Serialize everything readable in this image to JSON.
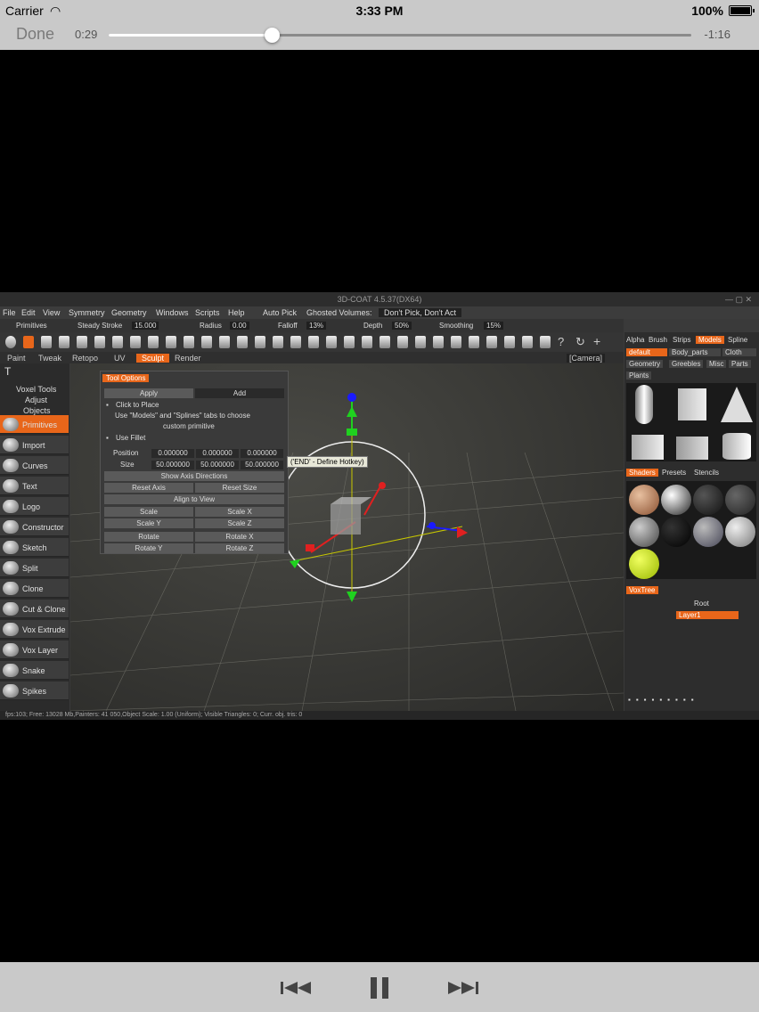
{
  "status_bar": {
    "carrier": "Carrier",
    "time": "3:33 PM",
    "battery": "100%"
  },
  "player": {
    "done": "Done",
    "elapsed": "0:29",
    "remaining": "-1:16",
    "progress": 0.28
  },
  "app": {
    "title": "3D-COAT 4.5.37(DX64)",
    "menu": [
      "File",
      "Edit",
      "View",
      "Symmetry",
      "Geometry",
      "Windows",
      "Scripts",
      "Help",
      "Auto Pick",
      "Ghosted Volumes:",
      "Don't Pick, Don't Act"
    ],
    "toolbar": {
      "primitives": "Primitives",
      "steady_stroke": "Steady Stroke",
      "steady_val": "15.000",
      "radius": "Radius",
      "radius_val": "0.00",
      "falloff": "Falloff",
      "falloff_val": "13%",
      "depth": "Depth",
      "depth_val": "50%",
      "smoothing": "Smoothing",
      "smoothing_val": "15%"
    },
    "room_tabs": [
      "Paint",
      "Tweak",
      "Retopo",
      "UV",
      "Sculpt",
      "Render"
    ],
    "active_room": "Sculpt",
    "camera": "[Camera]",
    "left_headers": [
      "Voxel Tools",
      "Adjust",
      "Objects"
    ],
    "left_tools": [
      "Primitives",
      "Import",
      "Curves",
      "Text",
      "Logo",
      "Constructor",
      "Sketch",
      "Split",
      "Clone",
      "Cut & Clone",
      "Vox Extrude",
      "Vox Layer",
      "Snake",
      "Spikes"
    ],
    "tool_options": {
      "title": "Tool Options",
      "apply": "Apply",
      "add": "Add",
      "click_to_place": "Click to Place",
      "hint1": "Use \"Models\" and \"Splines\" tabs to choose",
      "hint2": "custom primitive",
      "use_fillet": "Use Fillet",
      "position": "Position",
      "size": "Size",
      "pos_vals": [
        "0.000000",
        "0.000000",
        "0.000000"
      ],
      "size_vals": [
        "50.000000",
        "50.000000",
        "50.000000"
      ],
      "show_axis": "Show Axis Directions",
      "reset_axis": "Reset Axis",
      "reset_size": "Reset Size",
      "align": "Align to View",
      "scale": "Scale",
      "scale_x": "Scale X",
      "scale_y": "Scale Y",
      "scale_z": "Scale Z",
      "rotate": "Rotate",
      "rotate_x": "Rotate X",
      "rotate_y": "Rotate Y",
      "rotate_z": "Rotate Z"
    },
    "hotkey_tip": "('END' - Define Hotkey)",
    "right_tabs": [
      "Alpha",
      "Brush",
      "Strips",
      "Models",
      "Spline"
    ],
    "model_tabs": [
      "default",
      "Body_parts",
      "Cloth",
      "Geometry",
      "Greebles",
      "Misc",
      "Parts",
      "Plants"
    ],
    "shader_tabs": [
      "Shaders",
      "Presets",
      "Stencils"
    ],
    "voxtree": "VoxTree",
    "root": "Root",
    "layer": "Layer1",
    "statusline": "fps:103;  Free: 13028 Mb,Painters: 41 050,Object Scale: 1.00 (Uniform); Visible Triangles: 0; Curr. obj. tris: 0"
  }
}
